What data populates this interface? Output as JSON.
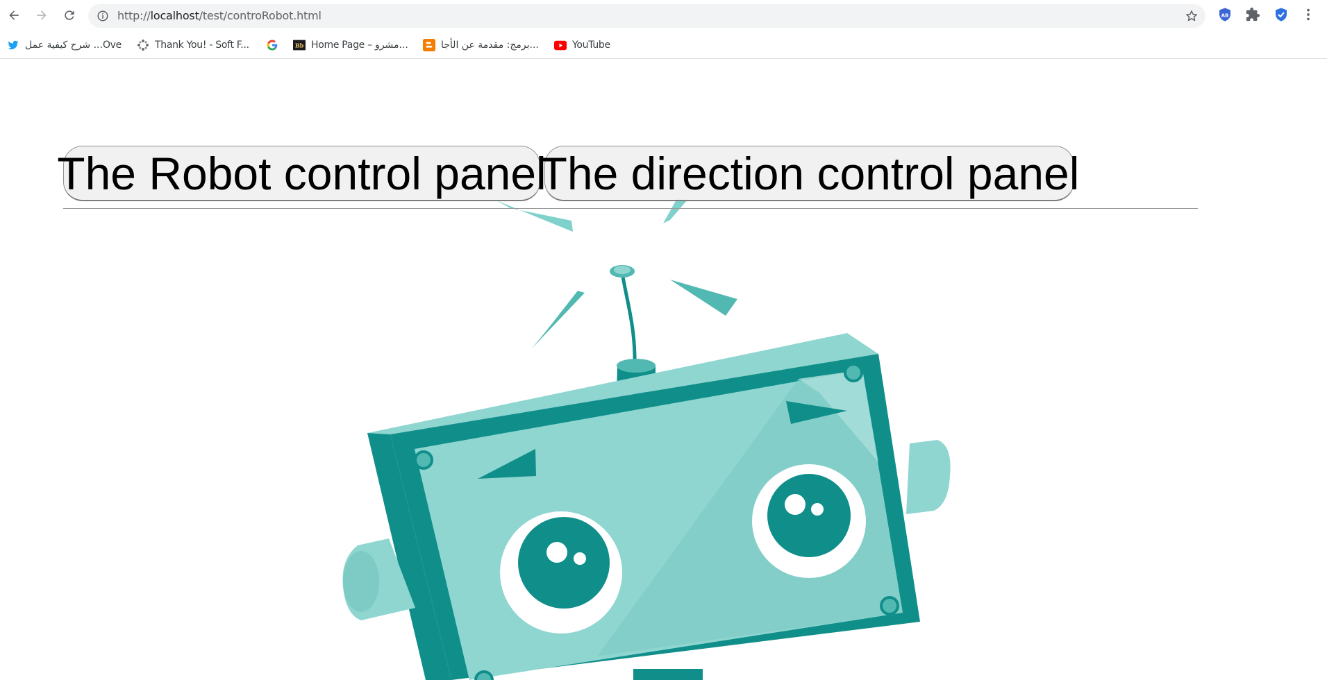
{
  "browser": {
    "url_prefix": "http://",
    "url_host": "localhost",
    "url_path": "/test/controRobot.html",
    "extensions": [
      "adblock-icon",
      "puzzle-icon",
      "shield-check-icon",
      "more-vert-icon"
    ],
    "bookmarks": [
      {
        "label": "شرح كيفية عمل ...Ove",
        "icon": "twitter-icon"
      },
      {
        "label": "Thank You! - Soft F...",
        "icon": "dots-icon"
      },
      {
        "label": "",
        "icon": "google-icon"
      },
      {
        "label": "Home Page – مشرو...",
        "icon": "bb-icon"
      },
      {
        "label": "برمج: مقدمة عن الأجا...",
        "icon": "blogger-icon"
      },
      {
        "label": "YouTube",
        "icon": "youtube-icon"
      }
    ]
  },
  "page": {
    "tabs": [
      {
        "label": "The Robot control panel"
      },
      {
        "label": "The direction control panel"
      }
    ]
  },
  "colors": {
    "robot_dark": "#108f8a",
    "robot_mid": "#52b8b2",
    "robot_light": "#8fd6d1"
  }
}
